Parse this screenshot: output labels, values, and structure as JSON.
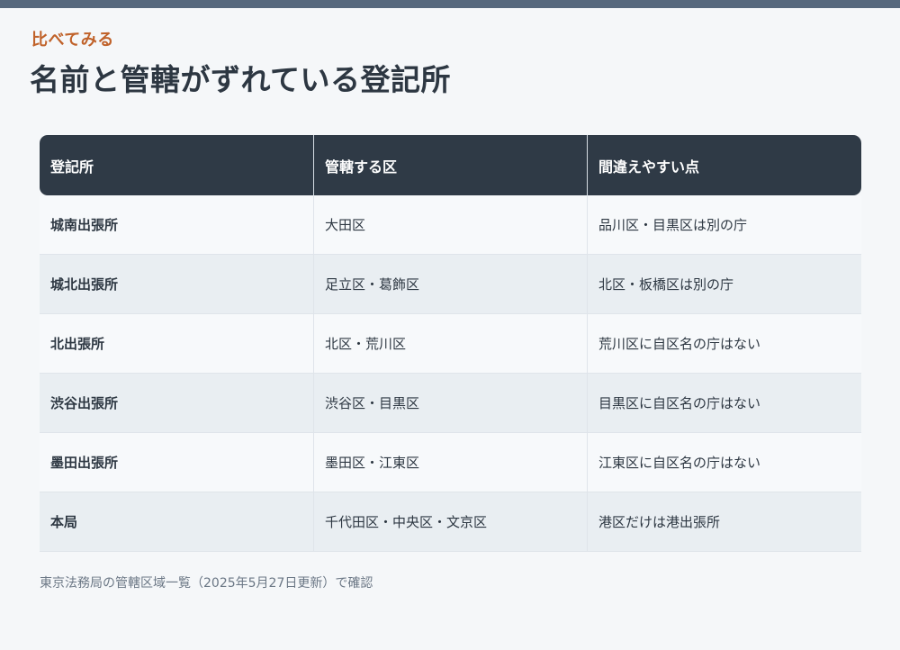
{
  "header": {
    "eyebrow": "比べてみる",
    "title": "名前と管轄がずれている登記所"
  },
  "table": {
    "columns": [
      "登記所",
      "管轄する区",
      "間違えやすい点"
    ],
    "rows": [
      [
        "城南出張所",
        "大田区",
        "品川区・目黒区は別の庁"
      ],
      [
        "城北出張所",
        "足立区・葛飾区",
        "北区・板橋区は別の庁"
      ],
      [
        "北出張所",
        "北区・荒川区",
        "荒川区に自区名の庁はない"
      ],
      [
        "渋谷出張所",
        "渋谷区・目黒区",
        "目黒区に自区名の庁はない"
      ],
      [
        "墨田出張所",
        "墨田区・江東区",
        "江東区に自区名の庁はない"
      ],
      [
        "本局",
        "千代田区・中央区・文京区",
        "港区だけは港出張所"
      ]
    ]
  },
  "footnote": "東京法務局の管轄区域一覧（2025年5月27日更新）で確認",
  "colors": {
    "accent": "#c0622a",
    "header_bg": "#2f3a46",
    "top_bar": "#56687d"
  }
}
